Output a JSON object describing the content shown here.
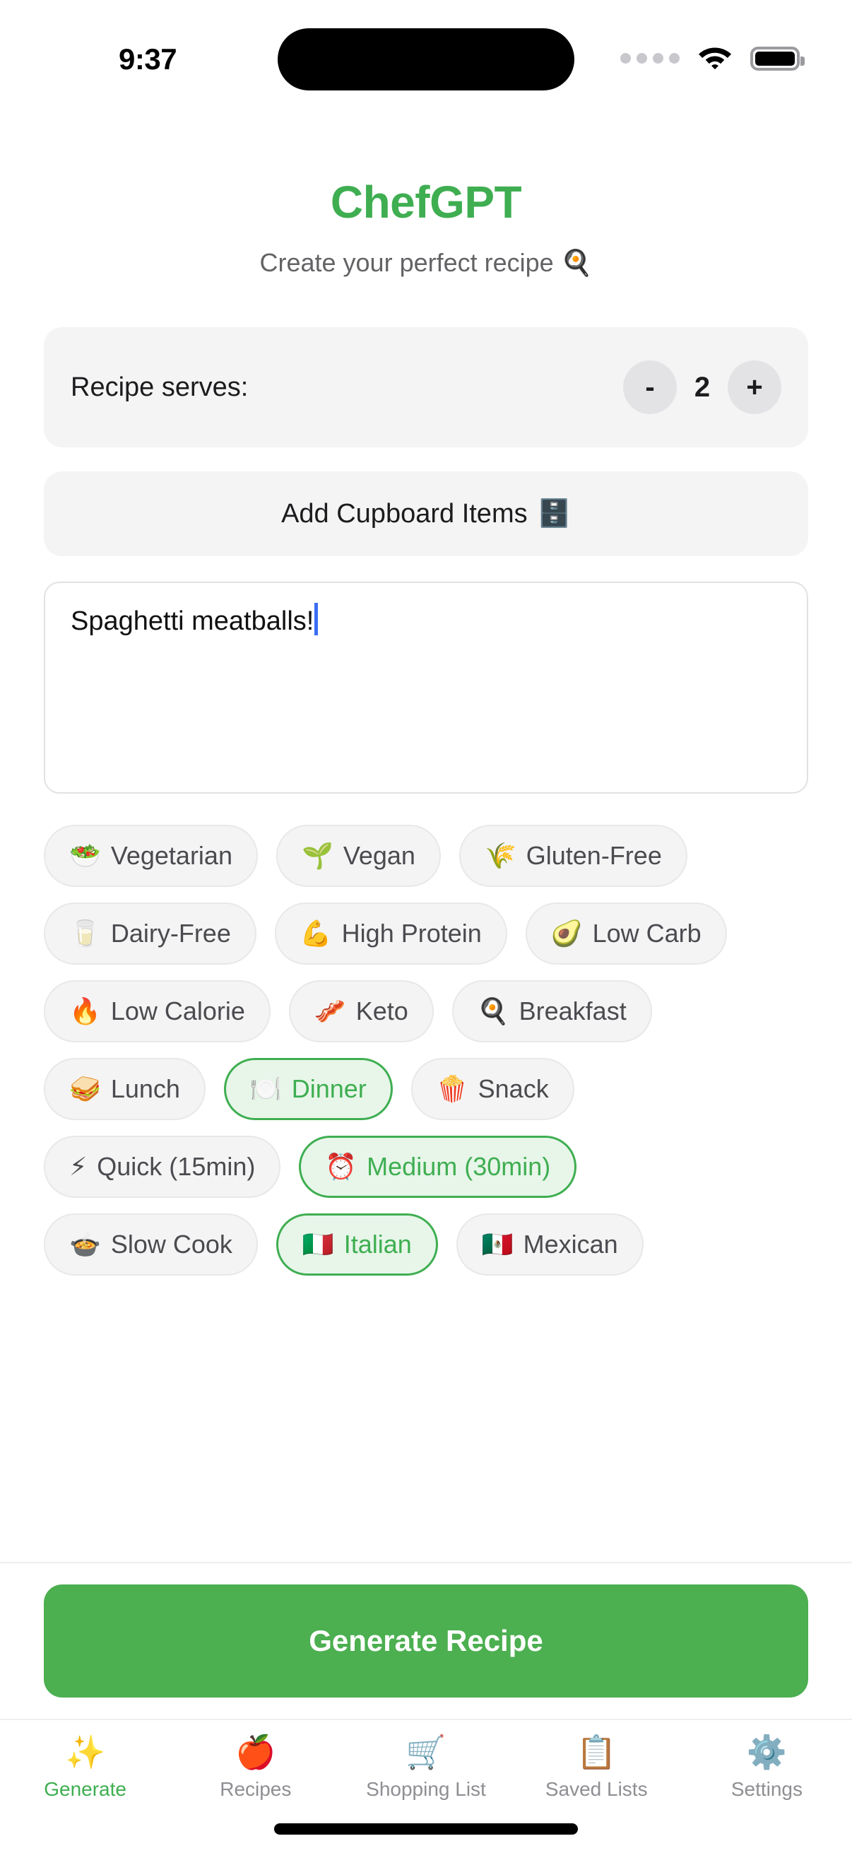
{
  "status_bar": {
    "time": "9:37",
    "signal_icon": "signal-dots",
    "wifi_icon": "wifi-icon",
    "battery_icon": "battery-full-icon"
  },
  "header": {
    "title": "ChefGPT",
    "subtitle": "Create your perfect recipe 🍳"
  },
  "serves": {
    "label": "Recipe serves:",
    "decrement_label": "-",
    "value": "2",
    "increment_label": "+"
  },
  "cupboard": {
    "label": "Add Cupboard Items",
    "emoji": "🗄️"
  },
  "recipe_input": {
    "value": "Spaghetti meatballs!",
    "placeholder": "What do you want to cook?"
  },
  "chips": [
    {
      "emoji": "🥗",
      "label": "Vegetarian",
      "selected": false
    },
    {
      "emoji": "🌱",
      "label": "Vegan",
      "selected": false
    },
    {
      "emoji": "🌾",
      "label": "Gluten-Free",
      "selected": false
    },
    {
      "emoji": "🥛",
      "label": "Dairy-Free",
      "selected": false
    },
    {
      "emoji": "💪",
      "label": "High Protein",
      "selected": false
    },
    {
      "emoji": "🥑",
      "label": "Low Carb",
      "selected": false
    },
    {
      "emoji": "🔥",
      "label": "Low Calorie",
      "selected": false
    },
    {
      "emoji": "🥓",
      "label": "Keto",
      "selected": false
    },
    {
      "emoji": "🍳",
      "label": "Breakfast",
      "selected": false
    },
    {
      "emoji": "🥪",
      "label": "Lunch",
      "selected": false
    },
    {
      "emoji": "🍽️",
      "label": "Dinner",
      "selected": true
    },
    {
      "emoji": "🍿",
      "label": "Snack",
      "selected": false
    },
    {
      "emoji": "⚡",
      "label": "Quick (15min)",
      "selected": false
    },
    {
      "emoji": "⏰",
      "label": "Medium (30min)",
      "selected": true
    },
    {
      "emoji": "🍲",
      "label": "Slow Cook",
      "selected": false
    },
    {
      "emoji": "🇮🇹",
      "label": "Italian",
      "selected": true
    },
    {
      "emoji": "🇲🇽",
      "label": "Mexican",
      "selected": false
    }
  ],
  "generate": {
    "label": "Generate Recipe"
  },
  "tabs": [
    {
      "emoji": "✨",
      "label": "Generate",
      "active": true
    },
    {
      "emoji": "🍎",
      "label": "Recipes",
      "active": false
    },
    {
      "emoji": "🛒",
      "label": "Shopping List",
      "active": false
    },
    {
      "emoji": "📋",
      "label": "Saved Lists",
      "active": false
    },
    {
      "emoji": "⚙️",
      "label": "Settings",
      "active": false
    }
  ],
  "colors": {
    "accent": "#3fae51",
    "button": "#4caf50",
    "chip_bg": "#f4f4f5",
    "chip_selected_bg": "#e7f6e9",
    "muted_text": "#8e8e93",
    "caret": "#3b6ef5"
  }
}
